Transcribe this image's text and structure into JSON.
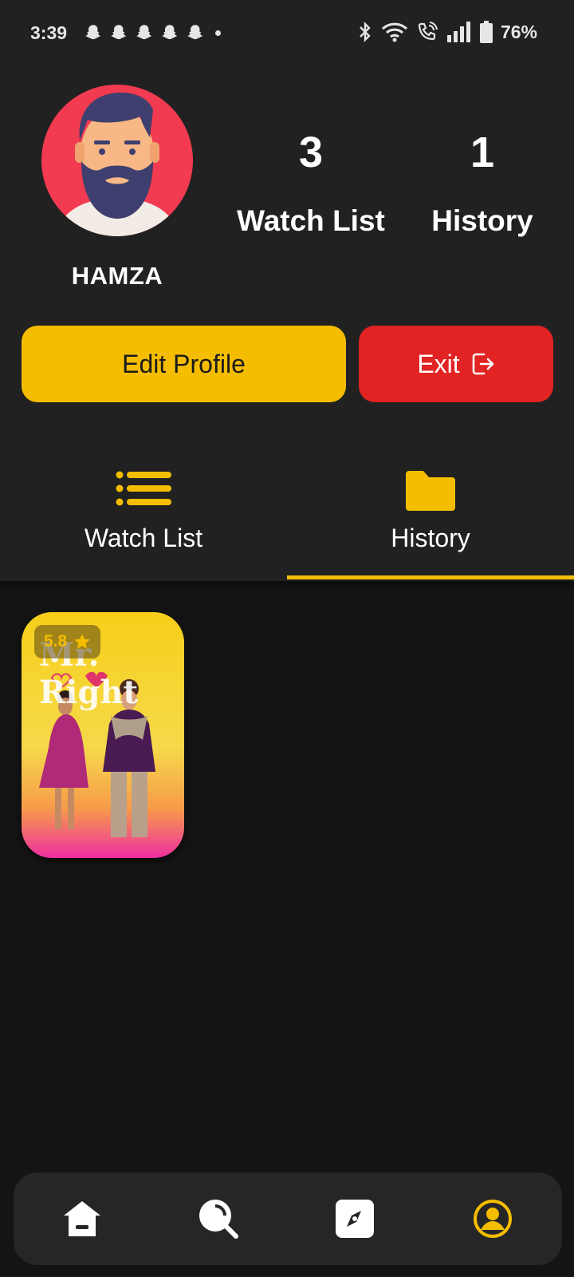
{
  "status_bar": {
    "time": "3:39",
    "battery": "76%",
    "notification_icons": [
      "snapchat-icon",
      "snapchat-icon",
      "snapchat-icon",
      "snapchat-icon",
      "snapchat-icon"
    ],
    "system_icons": [
      "bluetooth-icon",
      "wifi-icon",
      "wifi-calling-icon",
      "signal-icon",
      "battery-icon"
    ]
  },
  "profile": {
    "username": "HAMZA",
    "watch_list_count": "3",
    "watch_list_label": "Watch List",
    "history_count": "1",
    "history_label": "History"
  },
  "actions": {
    "edit_label": "Edit Profile",
    "exit_label": "Exit"
  },
  "tabs": [
    {
      "label": "Watch List",
      "icon": "list-icon",
      "active": false
    },
    {
      "label": "History",
      "icon": "folder-icon",
      "active": true
    }
  ],
  "history_items": [
    {
      "title": "Mr. Right",
      "rating": "5.8"
    }
  ],
  "nav": {
    "items": [
      "home-icon",
      "search-icon",
      "explore-icon",
      "profile-icon"
    ],
    "active": "profile-icon"
  },
  "colors": {
    "accent": "#f4bd00",
    "exit": "#e22323",
    "background": "#141414",
    "header": "#212121"
  }
}
